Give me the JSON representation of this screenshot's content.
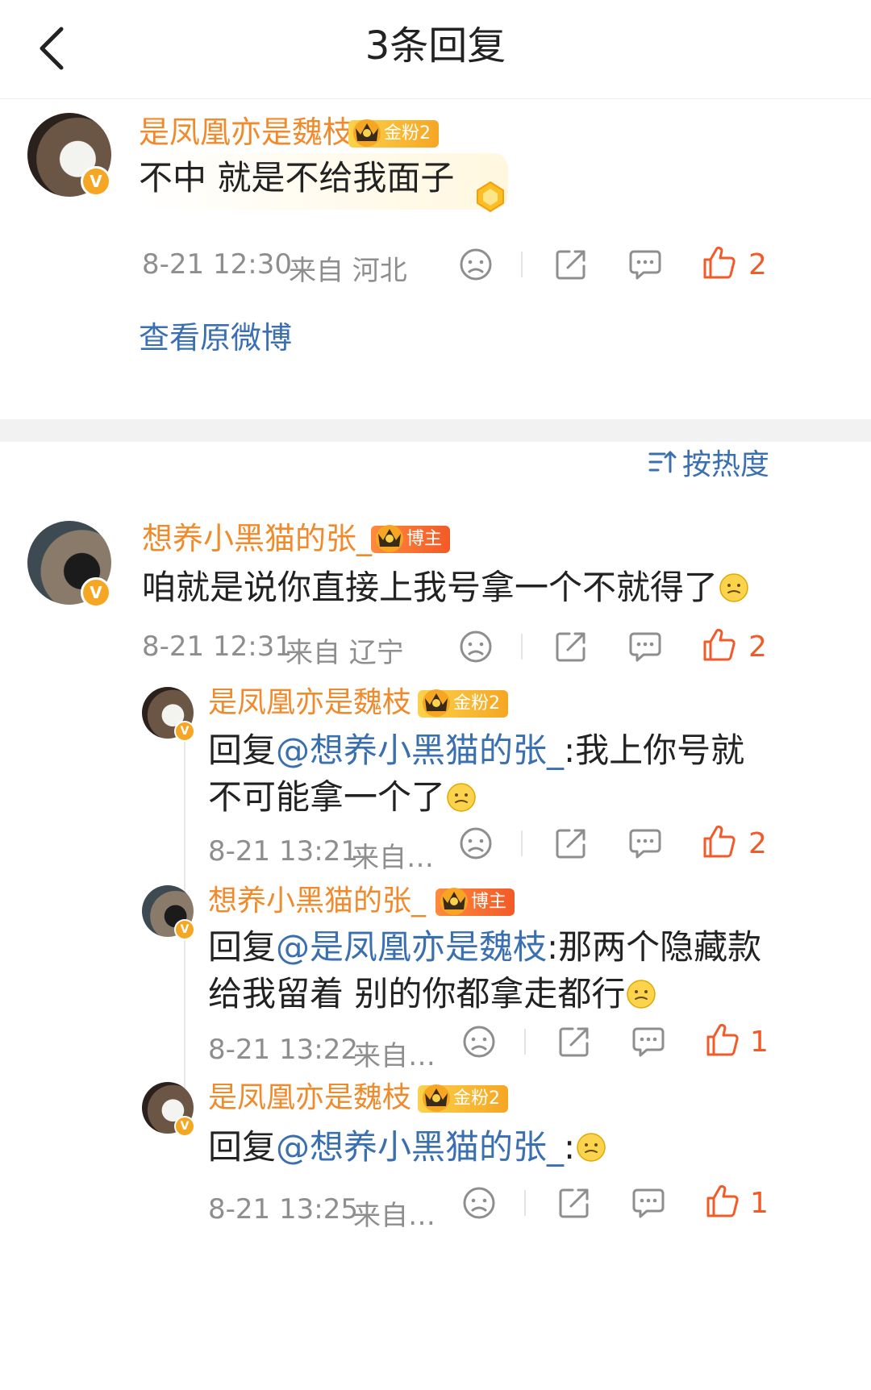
{
  "header": {
    "title": "3条回复"
  },
  "root": {
    "name": "是凤凰亦是魏枝",
    "tag": "金粉2",
    "content": "不中 就是不给我面子",
    "time": "8-21 12:30",
    "source": "来自 河北",
    "likes": "2"
  },
  "view_original": "查看原微博",
  "sort_label": "按热度",
  "reply": {
    "name": "想养小黑猫的张_",
    "tag": "博主",
    "content": "咱就是说你直接上我号拿一个不就得了",
    "time": "8-21 12:31",
    "source": "来自 辽宁",
    "likes": "2"
  },
  "subreplies": [
    {
      "name": "是凤凰亦是魏枝",
      "tag": "金粉2",
      "prefix": "回复",
      "mention": "@想养小黑猫的张_",
      "text": ":我上你号就不可能拿一个了",
      "time": "8-21 13:21",
      "source": "来自…",
      "likes": "2"
    },
    {
      "name": "想养小黑猫的张_",
      "tag": "博主",
      "prefix": "回复",
      "mention": "@是凤凰亦是魏枝",
      "text": ":那两个隐藏款给我留着 别的你都拿走都行",
      "time": "8-21 13:22",
      "source": "来自…",
      "likes": "1"
    },
    {
      "name": "是凤凰亦是魏枝",
      "tag": "金粉2",
      "prefix": "回复",
      "mention": "@想养小黑猫的张_",
      "text": ":",
      "time": "8-21 13:25",
      "source": "来自…",
      "likes": "1"
    }
  ],
  "colors": {
    "name": "#f08a2b",
    "link": "#3a6fb0",
    "like": "#f25a27"
  },
  "icons": [
    "back-chevron-icon",
    "dislike-face-icon",
    "share-icon",
    "comment-icon",
    "thumbs-up-icon",
    "verified-v-icon",
    "crown-icon",
    "sort-icon"
  ]
}
